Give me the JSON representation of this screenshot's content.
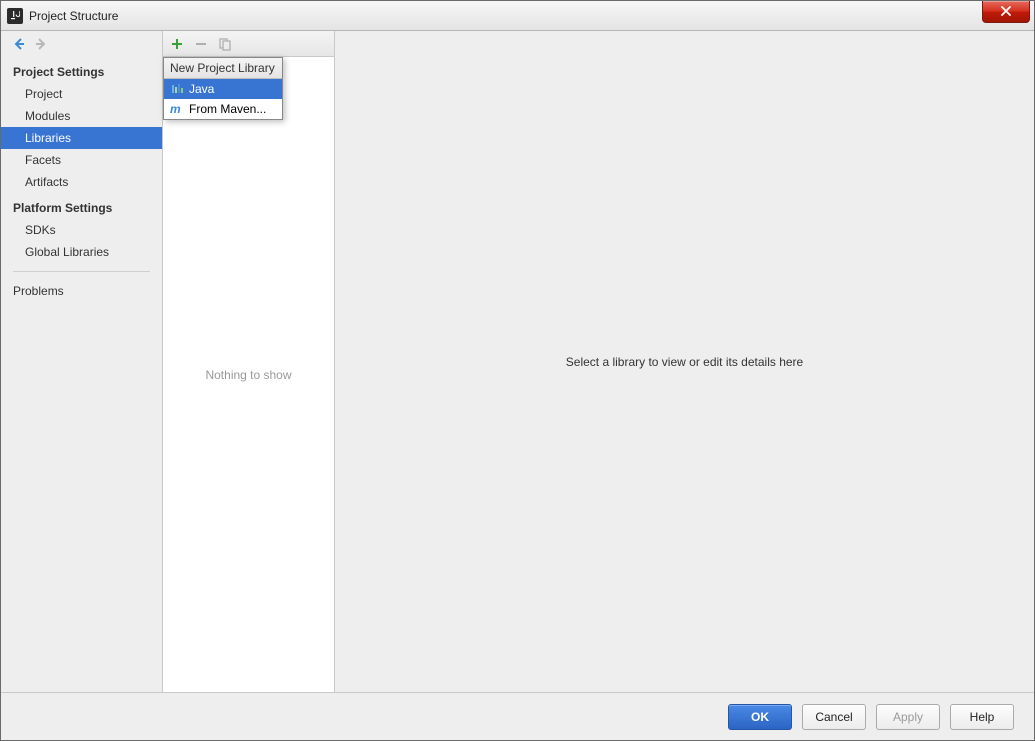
{
  "window": {
    "title": "Project Structure"
  },
  "sidebar": {
    "section1_title": "Project Settings",
    "section1_items": [
      "Project",
      "Modules",
      "Libraries",
      "Facets",
      "Artifacts"
    ],
    "section1_selected_index": 2,
    "section2_title": "Platform Settings",
    "section2_items": [
      "SDKs",
      "Global Libraries"
    ],
    "problems_label": "Problems"
  },
  "middle": {
    "empty_text": "Nothing to show"
  },
  "popup": {
    "title": "New Project Library",
    "items": [
      "Java",
      "From Maven..."
    ],
    "selected_index": 0
  },
  "detail": {
    "placeholder": "Select a library to view or edit its details here"
  },
  "footer": {
    "ok": "OK",
    "cancel": "Cancel",
    "apply": "Apply",
    "help": "Help"
  }
}
